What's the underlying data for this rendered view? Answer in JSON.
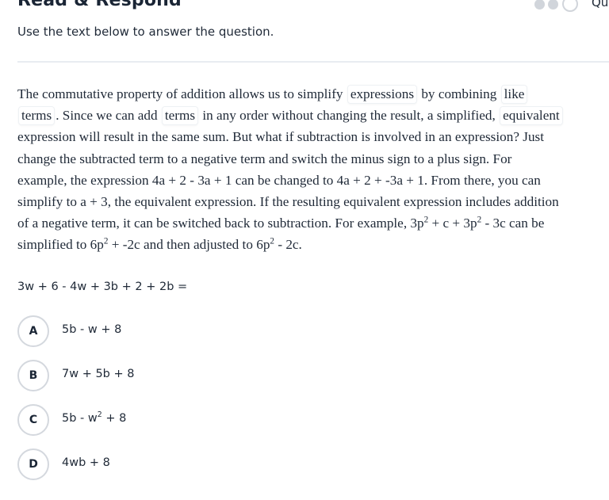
{
  "header": {
    "title": "Read & Respond",
    "progress": {
      "completed_steps": 2,
      "current_step": 3,
      "label": "Qu"
    },
    "instructions": "Use the text below to answer the question."
  },
  "passage": {
    "segments": [
      {
        "text": "The commutative property of addition allows us to simplify "
      },
      {
        "text": "expressions",
        "term": true
      },
      {
        "text": " by combining "
      },
      {
        "text": "like terms",
        "term": true,
        "split": [
          "like",
          "terms"
        ]
      },
      {
        "text": ". Since we can add "
      },
      {
        "text": "terms",
        "term": true
      },
      {
        "text": " in any order without changing the result, a simplified, "
      },
      {
        "text": "equivalent",
        "term": true
      },
      {
        "text": " expression will result in the same sum. But what if subtraction is involved in an expression? Just change the subtracted term to a negative term and switch the minus sign to a plus sign. For example, the expression 4a + 2 - 3a + 1 can be changed to 4a + 2 + -3a + 1. From there, you can simplify to a + 3, the equivalent expression. If the resulting equivalent expression includes addition of a negative term, it can be switched back to subtraction. For example, 3p"
      },
      {
        "text": "2",
        "sup": true
      },
      {
        "text": " + c + 3p"
      },
      {
        "text": "2",
        "sup": true
      },
      {
        "text": " - 3c can be simplified to 6p"
      },
      {
        "text": "2",
        "sup": true
      },
      {
        "text": " + -2c and then adjusted to 6p"
      },
      {
        "text": "2",
        "sup": true
      },
      {
        "text": " - 2c."
      }
    ]
  },
  "question": {
    "prompt": "3w + 6 - 4w + 3b + 2 + 2b =",
    "options": [
      {
        "letter": "A",
        "text": "5b - w + 8"
      },
      {
        "letter": "B",
        "text": "7w + 5b + 8"
      },
      {
        "letter": "C",
        "text_before": "5b - w",
        "sup": "2",
        "text_after": " + 8"
      },
      {
        "letter": "D",
        "text": "4wb + 8"
      }
    ]
  },
  "colors": {
    "title": "#1a2535",
    "text": "#1f2937",
    "divider": "#e8ecf1",
    "circle_border": "#d4d8de",
    "progress_dot": "#d1d5db"
  }
}
